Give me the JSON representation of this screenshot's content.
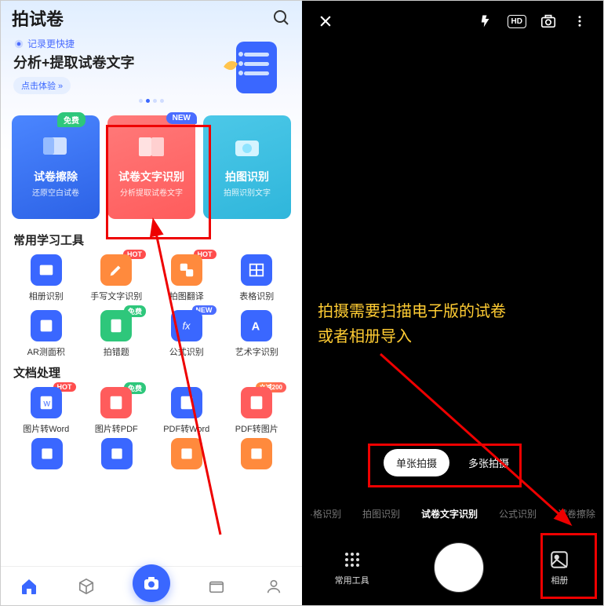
{
  "left": {
    "header_title": "拍试卷",
    "banner": {
      "sub": "记录更快捷",
      "title": "分析+提取试卷文字",
      "cta": "点击体验 »"
    },
    "cards": [
      {
        "title": "试卷擦除",
        "sub": "还原空白试卷",
        "badge": "免费"
      },
      {
        "title": "试卷文字识别",
        "sub": "分析提取试卷文字",
        "badge": "NEW"
      },
      {
        "title": "拍图识别",
        "sub": "拍照识别文字",
        "badge": ""
      }
    ],
    "section1_title": "常用学习工具",
    "tools1": [
      {
        "label": "相册识别",
        "badge": ""
      },
      {
        "label": "手写文字识别",
        "badge": "HOT"
      },
      {
        "label": "拍图翻译",
        "badge": "HOT"
      },
      {
        "label": "表格识别",
        "badge": ""
      },
      {
        "label": "AR测面积",
        "badge": ""
      },
      {
        "label": "拍错题",
        "badge": "免费"
      },
      {
        "label": "公式识别",
        "badge": "NEW"
      },
      {
        "label": "艺术字识别",
        "badge": ""
      }
    ],
    "section2_title": "文档处理",
    "tools2": [
      {
        "label": "图片转Word",
        "badge": "HOT"
      },
      {
        "label": "图片转PDF",
        "badge": "免费"
      },
      {
        "label": "PDF转Word",
        "badge": ""
      },
      {
        "label": "PDF转图片",
        "badge": "立减200"
      }
    ]
  },
  "right": {
    "hd": "HD",
    "annotation_line1": "拍摄需要扫描电子版的试卷",
    "annotation_line2": "或者相册导入",
    "shot_modes": {
      "single": "单张拍摄",
      "multi": "多张拍摄"
    },
    "cam_modes": [
      "·格识别",
      "拍图识别",
      "试卷文字识别",
      "公式识别",
      "试卷擦除"
    ],
    "bottom": {
      "grid_label": "常用工具",
      "album_label": "相册"
    }
  }
}
